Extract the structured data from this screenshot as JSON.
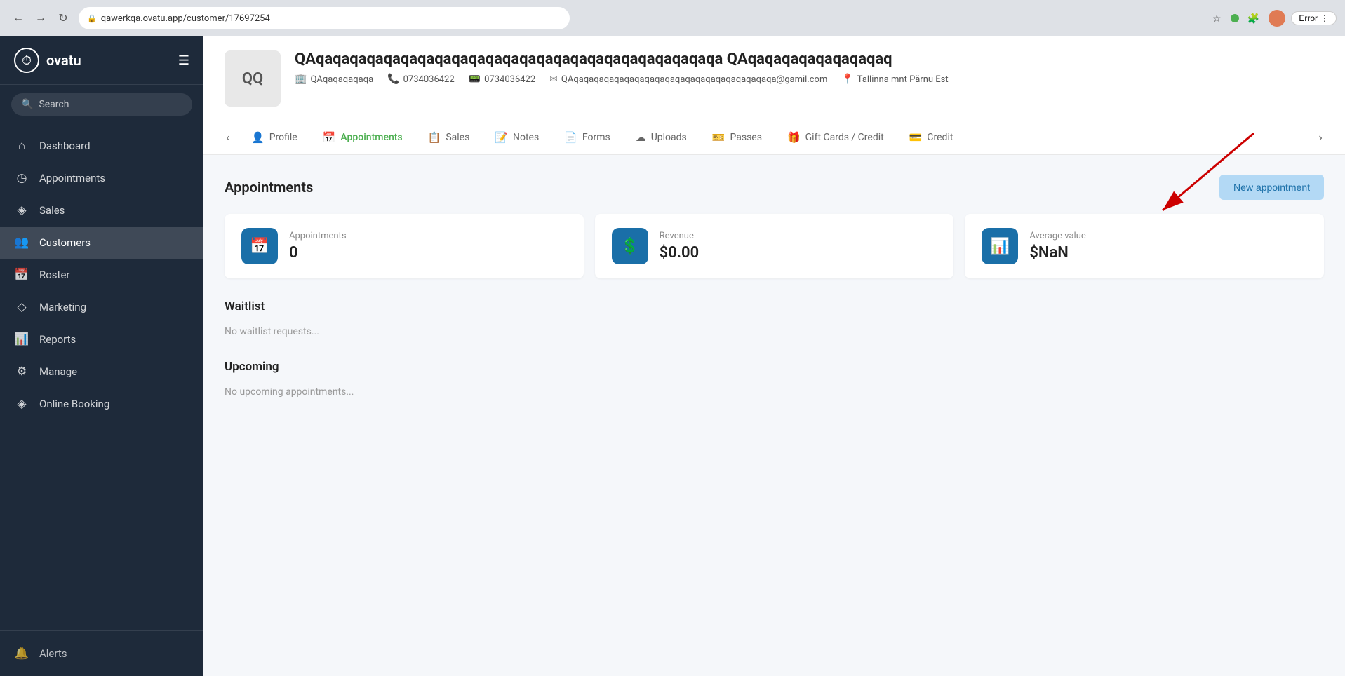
{
  "browser": {
    "url": "qawerkqa.ovatu.app/customer/17697254",
    "error_label": "Error"
  },
  "sidebar": {
    "logo_text": "ovatu",
    "search_placeholder": "Search",
    "items": [
      {
        "id": "dashboard",
        "label": "Dashboard",
        "icon": "⌂",
        "active": false
      },
      {
        "id": "appointments",
        "label": "Appointments",
        "icon": "◷",
        "active": false
      },
      {
        "id": "sales",
        "label": "Sales",
        "icon": "◈",
        "active": false
      },
      {
        "id": "customers",
        "label": "Customers",
        "icon": "👥",
        "active": true
      },
      {
        "id": "roster",
        "label": "Roster",
        "icon": "📅",
        "active": false
      },
      {
        "id": "marketing",
        "label": "Marketing",
        "icon": "◇",
        "active": false
      },
      {
        "id": "reports",
        "label": "Reports",
        "icon": "📊",
        "active": false
      },
      {
        "id": "manage",
        "label": "Manage",
        "icon": "⚙",
        "active": false
      },
      {
        "id": "online-booking",
        "label": "Online Booking",
        "icon": "◈",
        "active": false
      }
    ],
    "footer_items": [
      {
        "id": "alerts",
        "label": "Alerts",
        "icon": "🔔"
      }
    ]
  },
  "customer": {
    "initials": "QQ",
    "name": "QAqaqaqaqaqaqaqaqaqaqaqaqaqaqaqaqaqaqaqaqaqaqaqaqa QAqaqaqaqaqaqaqaqaq",
    "business": "QAqaqaqaqaqa",
    "phone1": "0734036422",
    "phone2": "0734036422",
    "email": "QAqaqaqaqaqaqaqaqaqaqaqaqaqaqaqaqaqaqaqaqa@gamil.com",
    "address": "Tallinna mnt Pärnu Est"
  },
  "tabs": [
    {
      "id": "profile",
      "label": "Profile",
      "icon": "👤",
      "active": false
    },
    {
      "id": "appointments",
      "label": "Appointments",
      "icon": "📅",
      "active": true
    },
    {
      "id": "sales",
      "label": "Sales",
      "icon": "📋",
      "active": false
    },
    {
      "id": "notes",
      "label": "Notes",
      "icon": "📝",
      "active": false
    },
    {
      "id": "forms",
      "label": "Forms",
      "icon": "📄",
      "active": false
    },
    {
      "id": "uploads",
      "label": "Uploads",
      "icon": "☁",
      "active": false
    },
    {
      "id": "passes",
      "label": "Passes",
      "icon": "🎫",
      "active": false
    },
    {
      "id": "gift-cards",
      "label": "Gift Cards / Credit",
      "icon": "🎁",
      "active": false
    },
    {
      "id": "credit",
      "label": "Credit",
      "icon": "💳",
      "active": false
    }
  ],
  "appointments_section": {
    "title": "Appointments",
    "new_appointment_label": "New appointment"
  },
  "stats": [
    {
      "id": "appointments-count",
      "label": "Appointments",
      "value": "0",
      "icon": "📅"
    },
    {
      "id": "revenue",
      "label": "Revenue",
      "value": "$0.00",
      "icon": "💲"
    },
    {
      "id": "average-value",
      "label": "Average value",
      "value": "$NaN",
      "icon": "📊"
    }
  ],
  "waitlist": {
    "title": "Waitlist",
    "empty_text": "No waitlist requests..."
  },
  "upcoming": {
    "title": "Upcoming",
    "empty_text": "No upcoming appointments..."
  }
}
